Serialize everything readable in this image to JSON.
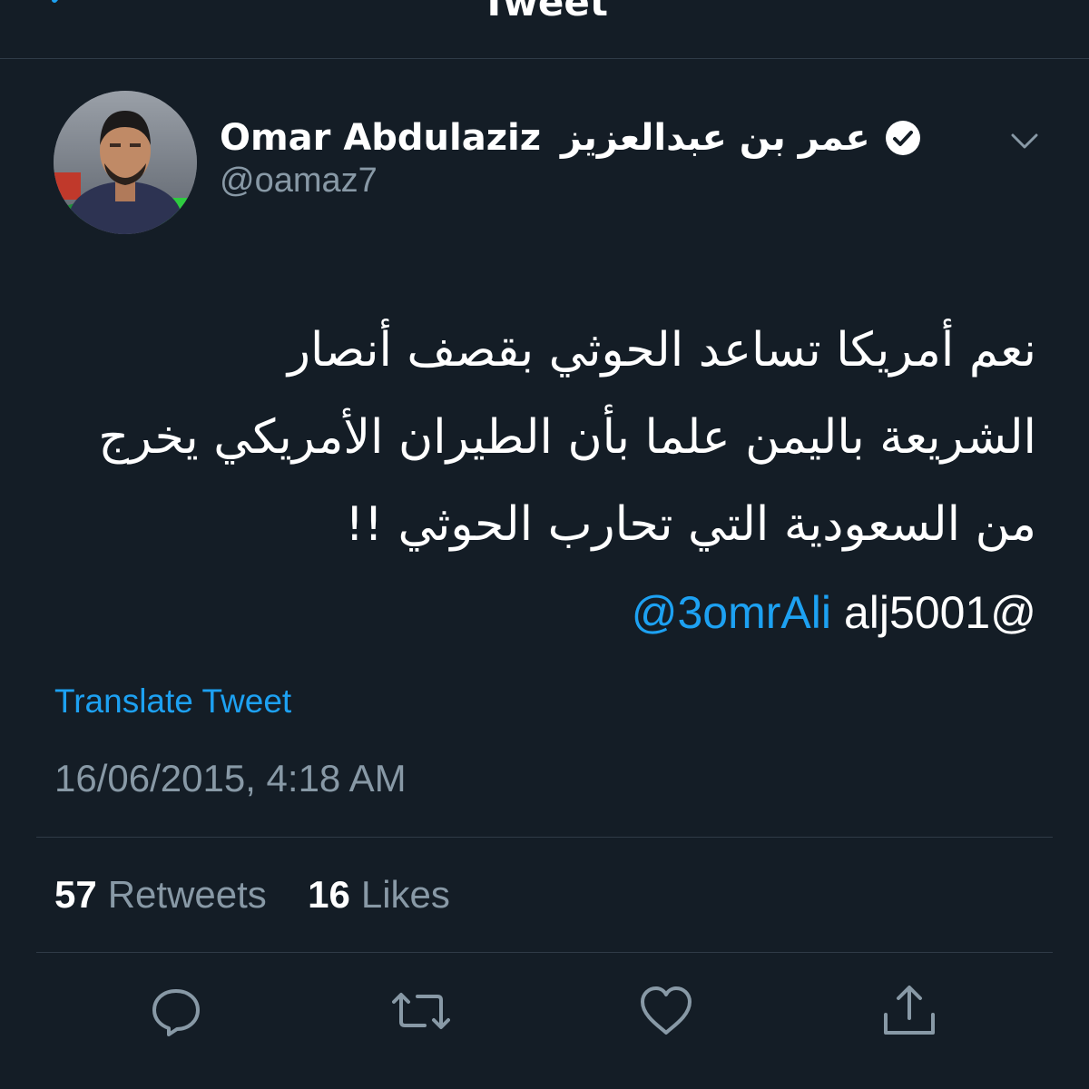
{
  "header": {
    "title": "Tweet",
    "back_icon": "chevron-left-icon"
  },
  "author": {
    "name": "Omar Abdulaziz",
    "name_ar": "عمر بن عبدالعزيز",
    "handle": "@oamaz7",
    "verified": true
  },
  "tweet": {
    "line1": "نعم أمريكا تساعد الحوثي بقصف أنصار",
    "line2": "الشريعة باليمن علما بأن الطيران الأمريكي يخرج",
    "line3": "من السعودية التي تحارب الحوثي !!",
    "mention_link": "@3omrAli",
    "mention_plain": "alj5001@"
  },
  "translate_label": "Translate Tweet",
  "timestamp": "16/06/2015, 4:18 AM",
  "stats": {
    "retweets_count": "57",
    "retweets_label": "Retweets",
    "likes_count": "16",
    "likes_label": "Likes"
  },
  "actions": [
    "reply-icon",
    "retweet-icon",
    "like-icon",
    "share-icon"
  ],
  "colors": {
    "background": "#141d26",
    "accent": "#1da1f2",
    "secondary_text": "#8899a6",
    "divider": "#2f3b47"
  }
}
